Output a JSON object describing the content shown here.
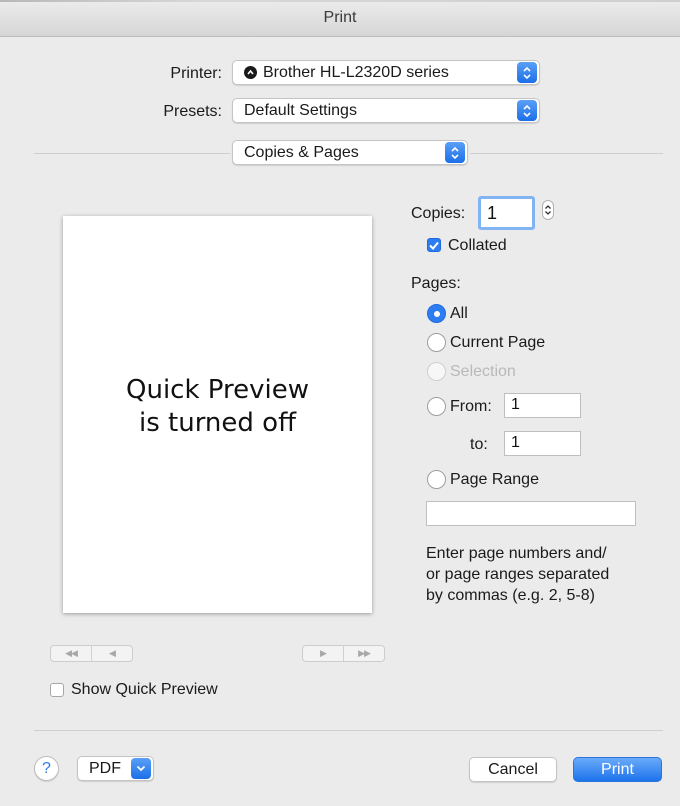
{
  "window": {
    "title": "Print"
  },
  "printer": {
    "label": "Printer:",
    "value": "Brother HL-L2320D series"
  },
  "presets": {
    "label": "Presets:",
    "value": "Default Settings"
  },
  "section": {
    "value": "Copies & Pages"
  },
  "preview": {
    "line1": "Quick Preview",
    "line2": "is turned off"
  },
  "copies": {
    "label": "Copies:",
    "value": "1",
    "collated_label": "Collated",
    "collated": true
  },
  "pages": {
    "label": "Pages:",
    "options": {
      "all": "All",
      "current": "Current Page",
      "selection": "Selection",
      "from": "From:",
      "to": "to:",
      "range": "Page Range"
    },
    "selected": "all",
    "from_value": "1",
    "to_value": "1",
    "range_value": "",
    "hint_lines": [
      "Enter page numbers and/",
      "or page ranges separated",
      "by commas (e.g. 2, 5-8)"
    ]
  },
  "show_quick_preview": {
    "label": "Show Quick Preview",
    "checked": false
  },
  "footer": {
    "help": "?",
    "pdf": "PDF",
    "cancel": "Cancel",
    "print": "Print"
  },
  "colors": {
    "accent": "#2d7cf0",
    "window_bg": "#ebebeb"
  }
}
